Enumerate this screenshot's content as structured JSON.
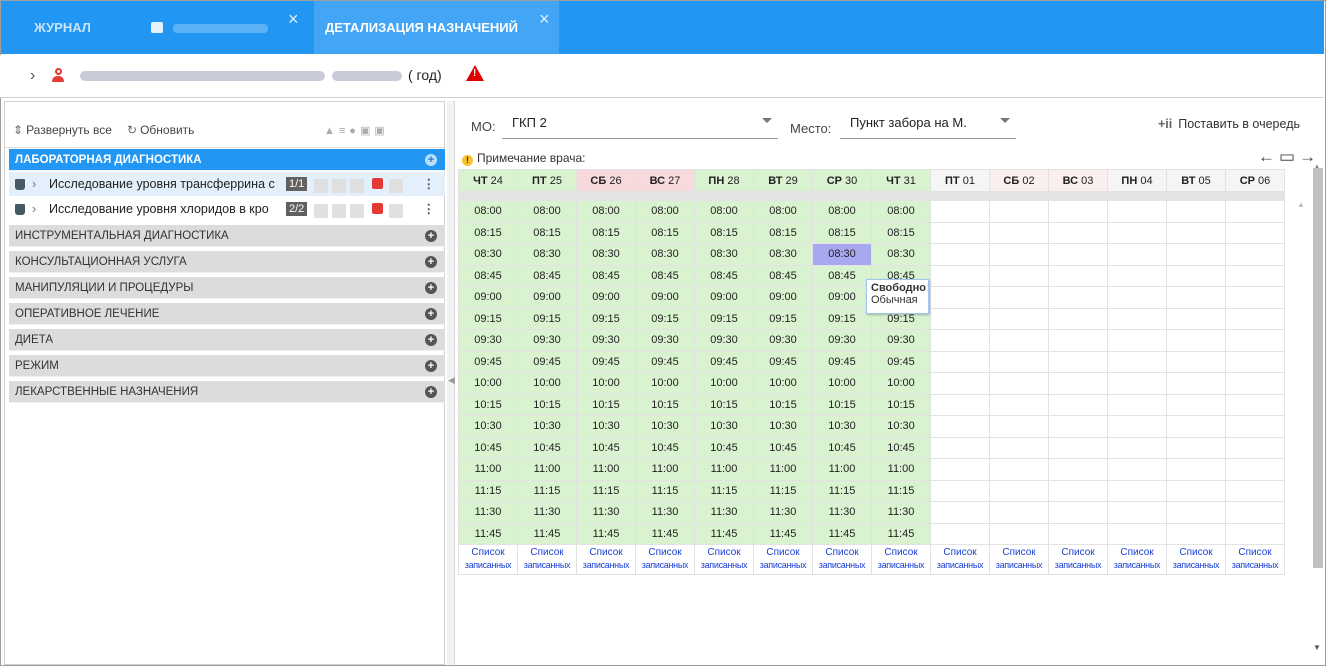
{
  "tabs": [
    {
      "label": "ЖУРНАЛ"
    },
    {
      "label": "",
      "blurred": true
    },
    {
      "label": "ДЕТАЛИЗАЦИЯ НАЗНАЧЕНИЙ",
      "active": true
    }
  ],
  "patient": {
    "age_text": "( год)"
  },
  "toolbar": {
    "expand_all": "Развернуть все",
    "refresh": "Обновить"
  },
  "categories": [
    {
      "label": "ЛАБОРАТОРНАЯ ДИАГНОСТИКА",
      "active": true
    },
    {
      "label": "ИНСТРУМЕНТАЛЬНАЯ ДИАГНОСТИКА"
    },
    {
      "label": "КОНСУЛЬТАЦИОННАЯ УСЛУГА"
    },
    {
      "label": "МАНИПУЛЯЦИИ И ПРОЦЕДУРЫ"
    },
    {
      "label": "ОПЕРАТИВНОЕ ЛЕЧЕНИЕ"
    },
    {
      "label": "ДИЕТА"
    },
    {
      "label": "РЕЖИМ"
    },
    {
      "label": "ЛЕКАРСТВЕННЫЕ НАЗНАЧЕНИЯ"
    }
  ],
  "lab_items": [
    {
      "text": "Исследование уровня трансферрина с",
      "badge": "1/1"
    },
    {
      "text": "Исследование уровня хлоридов в кро",
      "badge": "2/2"
    }
  ],
  "filters": {
    "mo_label": "МО:",
    "mo_value": "ГКП 2",
    "place_label": "Место:",
    "place_value": "Пункт забора на М."
  },
  "queue_button": "Поставить в очередь",
  "doctor_note": "Примечание врача:",
  "days": [
    {
      "dow": "ЧТ",
      "day": "24"
    },
    {
      "dow": "ПТ",
      "day": "25"
    },
    {
      "dow": "СБ",
      "day": "26"
    },
    {
      "dow": "ВС",
      "day": "27"
    },
    {
      "dow": "ПН",
      "day": "28"
    },
    {
      "dow": "ВТ",
      "day": "29"
    },
    {
      "dow": "СР",
      "day": "30"
    },
    {
      "dow": "ЧТ",
      "day": "31"
    },
    {
      "dow": "ПТ",
      "day": "01"
    },
    {
      "dow": "СБ",
      "day": "02"
    },
    {
      "dow": "ВС",
      "day": "03"
    },
    {
      "dow": "ПН",
      "day": "04"
    },
    {
      "dow": "ВТ",
      "day": "05"
    },
    {
      "dow": "СР",
      "day": "06"
    }
  ],
  "times": [
    "08:00",
    "08:15",
    "08:30",
    "08:45",
    "09:00",
    "09:15",
    "09:30",
    "09:45",
    "10:00",
    "10:15",
    "10:30",
    "10:45",
    "11:00",
    "11:15",
    "11:30",
    "11:45"
  ],
  "slot_day_count": 8,
  "selected_slot": {
    "day_index": 6,
    "time": "08:30"
  },
  "list_link": {
    "line1": "Список",
    "line2": "записанных"
  },
  "tooltip": {
    "status": "Свободно",
    "type": "Обычная"
  }
}
